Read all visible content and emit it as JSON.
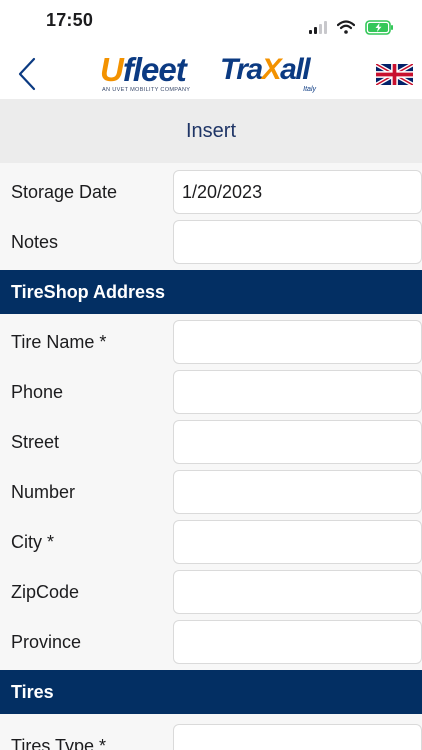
{
  "status_bar": {
    "time": "17:50"
  },
  "header": {
    "ufleet_logo": {
      "u": "U",
      "rest": "fleet",
      "tagline": "AN UVET MOBILITY COMPANY"
    },
    "traxall_logo": {
      "tra": "Tra",
      "x": "X",
      "all": "all",
      "sub": "Italy"
    }
  },
  "title": "Insert",
  "storage": {
    "storage_date": {
      "label": "Storage Date",
      "value": "1/20/2023"
    },
    "notes": {
      "label": "Notes",
      "value": ""
    }
  },
  "tireshop": {
    "section_title": "TireShop Address",
    "fields": [
      {
        "label": "Tire Name *",
        "value": ""
      },
      {
        "label": "Phone",
        "value": ""
      },
      {
        "label": "Street",
        "value": ""
      },
      {
        "label": "Number",
        "value": ""
      },
      {
        "label": "City *",
        "value": ""
      },
      {
        "label": "ZipCode",
        "value": ""
      },
      {
        "label": "Province",
        "value": ""
      }
    ]
  },
  "tires": {
    "section_title": "Tires",
    "fields": [
      {
        "label": "Tires Type *",
        "value": ""
      }
    ]
  },
  "colors": {
    "section_header": "#032f63",
    "title_text": "#1f3566",
    "brand_orange": "#f39200",
    "brand_blue": "#0b3a82",
    "battery_green": "#34c759"
  },
  "icons": {
    "back": "chevron-left-icon",
    "language": "uk-flag-icon",
    "signal": "signal-icon",
    "wifi": "wifi-icon",
    "battery": "battery-charging-icon"
  }
}
